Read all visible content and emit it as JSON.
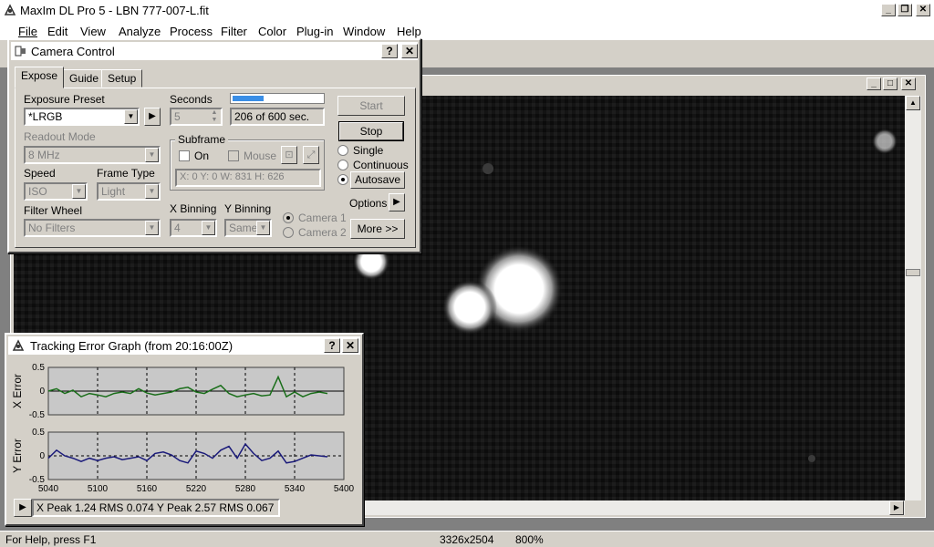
{
  "app": {
    "title": "MaxIm DL Pro 5 - LBN 777-007-L.fit",
    "menu": [
      "File",
      "Edit",
      "View",
      "Analyze",
      "Process",
      "Filter",
      "Color",
      "Plug-in",
      "Window",
      "Help"
    ]
  },
  "camera": {
    "title": "Camera Control",
    "tabs": [
      "Expose",
      "Guide",
      "Setup"
    ],
    "exposure_preset_label": "Exposure Preset",
    "exposure_preset_value": "*LRGB",
    "seconds_label": "Seconds",
    "seconds_value": "5",
    "progress_text": "206 of 600 sec.",
    "progress_fraction": 0.343,
    "readout_label": "Readout Mode",
    "readout_value": "8 MHz",
    "speed_label": "Speed",
    "speed_value": "ISO",
    "frame_type_label": "Frame Type",
    "frame_type_value": "Light",
    "filter_label": "Filter Wheel",
    "filter_value": "No Filters",
    "subframe_label": "Subframe",
    "on_label": "On",
    "mouse_label": "Mouse",
    "subframe_info": "X:   0 Y:   0 W: 831 H: 626",
    "xbin_label": "X Binning",
    "xbin_value": "4",
    "ybin_label": "Y Binning",
    "ybin_value": "Same",
    "camera1": "Camera 1",
    "camera2": "Camera 2",
    "start": "Start",
    "stop": "Stop",
    "single": "Single",
    "continuous": "Continuous",
    "autosave": "Autosave",
    "options": "Options",
    "more": "More >>"
  },
  "tracking": {
    "title": "Tracking Error Graph (from 20:16:00Z)",
    "x_axis_label": "X Error",
    "y_axis_label": "Y Error",
    "stats": "X Peak 1.24   RMS 0.074    Y Peak 2.57   RMS 0.067"
  },
  "status": {
    "help": "For Help, press F1",
    "size": "3326x2504",
    "zoom": "800%"
  },
  "colors": {
    "x_series": "#1a6e1a",
    "y_series": "#1a1a7a",
    "progress": "#3a8ee6"
  },
  "chart_data": [
    {
      "type": "line",
      "ylabel": "X Error",
      "ylim": [
        -0.5,
        0.5
      ],
      "yticks": [
        "0.5",
        "0",
        "-0.5"
      ],
      "xlim": [
        5040,
        5400
      ],
      "grid": true,
      "series": [
        {
          "x": [
            5040,
            5050,
            5060,
            5070,
            5080,
            5090,
            5100,
            5110,
            5120,
            5130,
            5140,
            5150,
            5160,
            5170,
            5180,
            5190,
            5200,
            5210,
            5220,
            5230,
            5240,
            5250,
            5260,
            5270,
            5280,
            5290,
            5300,
            5310,
            5320,
            5330,
            5340,
            5350,
            5360,
            5370,
            5380
          ],
          "y": [
            0.0,
            0.05,
            -0.05,
            0.02,
            -0.12,
            -0.05,
            -0.08,
            -0.12,
            -0.05,
            -0.02,
            -0.05,
            0.05,
            -0.04,
            -0.08,
            -0.05,
            -0.02,
            0.05,
            0.08,
            -0.02,
            -0.05,
            0.04,
            0.12,
            -0.05,
            -0.12,
            -0.08,
            -0.05,
            -0.1,
            -0.08,
            0.3,
            -0.12,
            -0.02,
            -0.12,
            -0.05,
            -0.02,
            -0.05
          ]
        }
      ]
    },
    {
      "type": "line",
      "ylabel": "Y Error",
      "ylim": [
        -0.5,
        0.5
      ],
      "yticks": [
        "0.5",
        "0",
        "-0.5"
      ],
      "xlim": [
        5040,
        5400
      ],
      "xticks": [
        "5040",
        "5100",
        "5160",
        "5220",
        "5280",
        "5340",
        "5400"
      ],
      "grid": true,
      "series": [
        {
          "x": [
            5040,
            5050,
            5060,
            5070,
            5080,
            5090,
            5100,
            5110,
            5120,
            5130,
            5140,
            5150,
            5160,
            5170,
            5180,
            5190,
            5200,
            5210,
            5220,
            5230,
            5240,
            5250,
            5260,
            5270,
            5280,
            5290,
            5300,
            5310,
            5320,
            5330,
            5340,
            5350,
            5360,
            5370,
            5380
          ],
          "y": [
            -0.05,
            0.12,
            0.0,
            -0.05,
            -0.12,
            -0.05,
            -0.1,
            -0.05,
            -0.02,
            -0.08,
            -0.05,
            -0.02,
            -0.1,
            0.05,
            0.08,
            0.02,
            -0.1,
            -0.15,
            0.1,
            0.05,
            -0.05,
            0.12,
            0.2,
            -0.05,
            0.25,
            0.05,
            -0.1,
            -0.05,
            0.1,
            -0.15,
            -0.12,
            -0.05,
            0.02,
            0.0,
            -0.02
          ]
        }
      ]
    }
  ]
}
